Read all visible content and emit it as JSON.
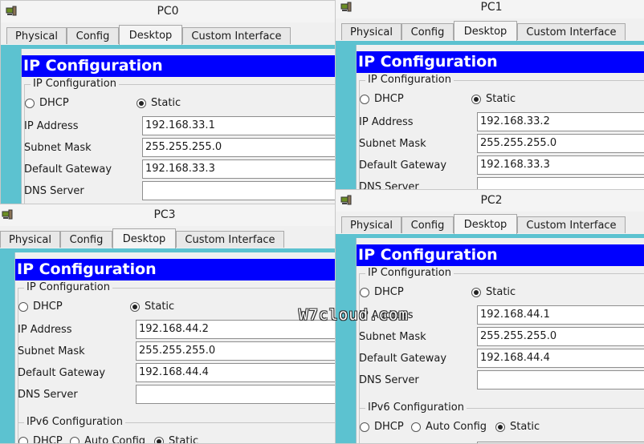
{
  "icon": "packet-tracer-pc-icon",
  "tabs": [
    "Physical",
    "Config",
    "Desktop",
    "Custom Interface"
  ],
  "section_header": "IP Configuration",
  "group_ip": "IP Configuration",
  "group_ipv6": "IPv6 Configuration",
  "dhcp": "DHCP",
  "static": "Static",
  "auto_config": "Auto Config",
  "labels": {
    "ip": "IP Address",
    "mask": "Subnet Mask",
    "gateway": "Default Gateway",
    "dns": "DNS Server"
  },
  "windows": {
    "pc0": {
      "title": "PC0",
      "ip": "192.168.33.1",
      "mask": "255.255.255.0",
      "gateway": "192.168.33.3",
      "dns": ""
    },
    "pc1": {
      "title": "PC1",
      "ip": "192.168.33.2",
      "mask": "255.255.255.0",
      "gateway": "192.168.33.3",
      "dns": ""
    },
    "pc3": {
      "title": "PC3",
      "ip": "192.168.44.2",
      "mask": "255.255.255.0",
      "gateway": "192.168.44.4",
      "dns": ""
    },
    "pc2": {
      "title": "PC2",
      "ip": "192.168.44.1",
      "mask": "255.255.255.0",
      "gateway": "192.168.44.4",
      "dns": ""
    }
  },
  "watermark": "W7cloud.com",
  "colors": {
    "header_blue": "#0000ff",
    "frame_cyan": "#5cc2d0",
    "window_bg": "#f0f0f0"
  }
}
